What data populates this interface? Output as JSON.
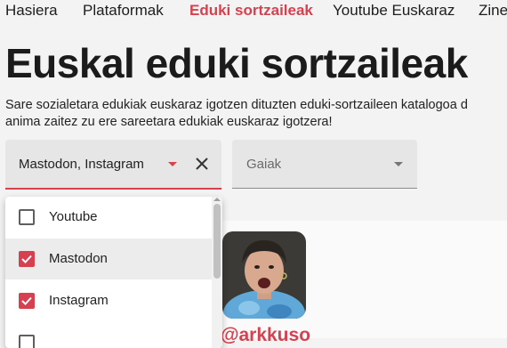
{
  "nav": {
    "items": [
      {
        "label": "Hasiera",
        "active": false
      },
      {
        "label": "Plataformak",
        "active": false
      },
      {
        "label": "Eduki sortzaileak",
        "active": true
      },
      {
        "label": "Youtube Euskaraz",
        "active": false
      },
      {
        "label": "Zine",
        "active": false
      }
    ]
  },
  "page": {
    "title": "Euskal eduki sortzaileak",
    "description_line1": "Sare sozialetara edukiak euskaraz igotzen dituzten eduki-sortzaileen katalogoa d",
    "description_line2": "anima zaitez zu ere sareetara edukiak euskaraz igotzera!"
  },
  "filters": {
    "platform": {
      "value": "Mastodon, Instagram"
    },
    "topics": {
      "placeholder": "Gaiak"
    }
  },
  "dropdown": {
    "options": [
      {
        "label": "Youtube",
        "checked": false
      },
      {
        "label": "Mastodon",
        "checked": true
      },
      {
        "label": "Instagram",
        "checked": true
      },
      {
        "label": "",
        "checked": false
      }
    ]
  },
  "creator_card": {
    "handle": "@arkkuso"
  },
  "colors": {
    "accent": "#d6404f",
    "background": "#f3f3f3",
    "field": "#e6e6e6"
  }
}
